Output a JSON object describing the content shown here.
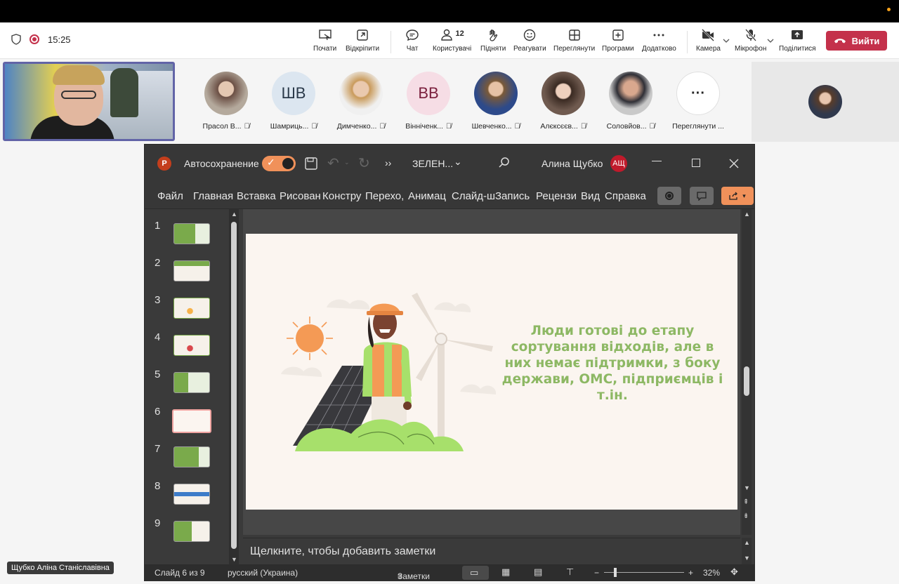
{
  "meeting": {
    "time": "15:25"
  },
  "toolbar": {
    "buttons": [
      {
        "id": "start",
        "label": "Почати"
      },
      {
        "id": "popout",
        "label": "Відкріпити"
      },
      {
        "id": "chat",
        "label": "Чат"
      },
      {
        "id": "people",
        "label": "Користувачі",
        "count": "12"
      },
      {
        "id": "raise",
        "label": "Підняти"
      },
      {
        "id": "react",
        "label": "Реагувати"
      },
      {
        "id": "view",
        "label": "Переглянути"
      },
      {
        "id": "apps",
        "label": "Програми"
      },
      {
        "id": "more",
        "label": "Додатково"
      },
      {
        "id": "camera",
        "label": "Камера"
      },
      {
        "id": "mic",
        "label": "Мікрофон"
      },
      {
        "id": "share",
        "label": "Поділитися"
      }
    ],
    "leave_label": "Вийти"
  },
  "participants": [
    {
      "name": "Прасол В...",
      "initials": ""
    },
    {
      "name": "Шамриць...",
      "initials": "ШВ"
    },
    {
      "name": "Димченко...",
      "initials": ""
    },
    {
      "name": "Вінніченк...",
      "initials": "ВВ"
    },
    {
      "name": "Шевченко...",
      "initials": ""
    },
    {
      "name": "Алєксєєв...",
      "initials": ""
    },
    {
      "name": "Соловйов...",
      "initials": ""
    },
    {
      "name": "Переглянути ...",
      "initials": "···"
    }
  ],
  "colors": {
    "leave": "#c4314b",
    "accent": "#6264a7",
    "ppt_orange": "#f0915a",
    "slide_text": "#8db864"
  },
  "powerpoint": {
    "autosave_label": "Автосохранение",
    "doc_name": "ЗЕЛЕН...",
    "user_name": "Алина Щубко",
    "user_initials": "АЩ",
    "tabs": [
      "Файл",
      "Главная",
      "Вставка",
      "Рисован",
      "Констру",
      "Перехо,",
      "Анимац",
      "Слайд-ш",
      "Запись",
      "Рецензи",
      "Вид",
      "Справка"
    ],
    "slides": [
      "1",
      "2",
      "3",
      "4",
      "5",
      "6",
      "7",
      "8",
      "9"
    ],
    "selected_slide": "6",
    "slide_text": "Люди готові до етапу сортування відходів, але в них немає підтримки, з боку держави, ОМС, підприємців і т.ін.",
    "notes_placeholder": "Щелкните, чтобы добавить заметки",
    "status": {
      "slide": "Слайд 6 из 9",
      "lang": "русский (Украина)",
      "notes": "Заметки",
      "zoom": "32%"
    }
  },
  "self_name": "Щубко Аліна Станіславівна"
}
